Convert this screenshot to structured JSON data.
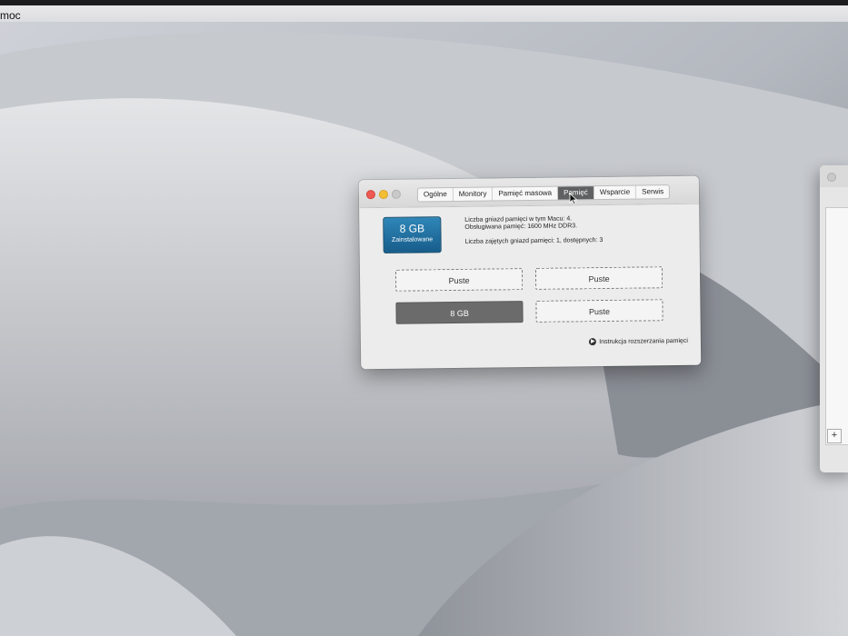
{
  "menubar": {
    "app_menu_label": "moc"
  },
  "window": {
    "tabs": [
      {
        "label": "Ogólne",
        "active": false
      },
      {
        "label": "Monitory",
        "active": false
      },
      {
        "label": "Pamięć masowa",
        "active": false
      },
      {
        "label": "Pamięć",
        "active": true
      },
      {
        "label": "Wsparcie",
        "active": false
      },
      {
        "label": "Serwis",
        "active": false
      }
    ],
    "memory_badge": {
      "size": "8 GB",
      "label": "Zainstalowane"
    },
    "info_lines": [
      "Liczba gniazd pamięci w tym Macu: 4.",
      "Obsługiwana pamięć: 1600 MHz DDR3.",
      "Liczba zajętych gniazd pamięci: 1, dostępnych: 3"
    ],
    "slots": [
      "Puste",
      "Puste",
      "8  GB",
      "Puste"
    ],
    "upgrade_link": "Instrukcja rozszerzania pamięci"
  },
  "side_window": {
    "plus_label": "+"
  },
  "colors": {
    "badge": "#1f6f9e",
    "active_tab": "#5f6061",
    "filled_slot": "#6b6b6b"
  }
}
